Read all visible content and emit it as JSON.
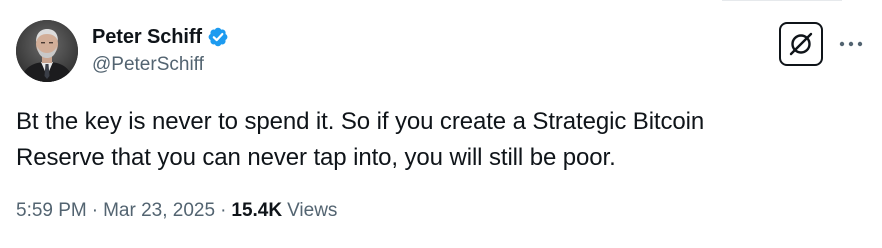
{
  "author": {
    "display_name": "Peter Schiff",
    "handle": "@PeterSchiff",
    "verified": true,
    "avatar_icon": "profile-photo"
  },
  "tweet": {
    "text": "Bt the key is never to spend it. So if you create a Strategic Bitcoin\nReserve that you can never tap into, you will still be poor.",
    "time": "5:59 PM",
    "date": "Mar 23, 2025",
    "separator": "·",
    "views_count": "15.4K",
    "views_label": "Views"
  },
  "actions": {
    "grok_icon": "grok-icon",
    "more_icon": "more-icon"
  },
  "colors": {
    "verified_blue": "#1d9bf0",
    "text_primary": "#0f1419",
    "text_secondary": "#536471"
  }
}
